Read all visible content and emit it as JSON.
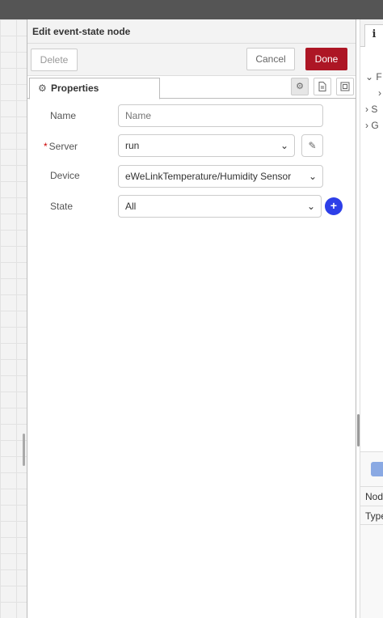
{
  "dialog": {
    "title": "Edit event-state node",
    "delete_label": "Delete",
    "cancel_label": "Cancel",
    "done_label": "Done",
    "tab_label": "Properties"
  },
  "form": {
    "name": {
      "label": "Name",
      "placeholder": "Name",
      "value": ""
    },
    "server": {
      "required_mark": "*",
      "label": "Server",
      "value": "run"
    },
    "device": {
      "label": "Device",
      "value": "eWeLinkTemperature/Humidity Sensor"
    },
    "state": {
      "label": "State",
      "value": "All"
    },
    "add_symbol": "+"
  },
  "sidebar": {
    "info_tab": "i",
    "items": [
      "F",
      "S",
      "G"
    ],
    "rows": [
      "Nod",
      "Type"
    ]
  },
  "icons": [
    "gear-icon",
    "document-icon",
    "frame-icon",
    "pencil-icon",
    "chevron-down-icon"
  ],
  "colors": {
    "done_button": "#ad1625",
    "add_button": "#2d3fe8",
    "required_mark": "#cc0000"
  }
}
